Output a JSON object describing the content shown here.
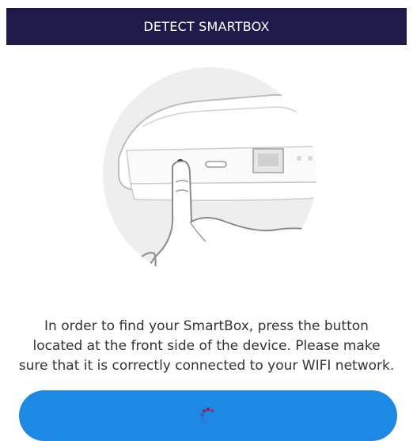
{
  "header": {
    "title": "DETECT SMARTBOX"
  },
  "illustration": {
    "icon": "smartbox-button-press-illustration"
  },
  "instructions": {
    "lines": [
      "In order to find your SmartBox, press the button",
      "located at the front side of the device. Please make",
      "sure that it is correctly connected to your WIFI network."
    ]
  },
  "detect_button": {
    "state": "loading",
    "icon": "loading-spinner-icon"
  },
  "colors": {
    "header_bg": "#1e1b4a",
    "button_bg": "#1e88e5",
    "spinner": "#8e1f4f"
  }
}
